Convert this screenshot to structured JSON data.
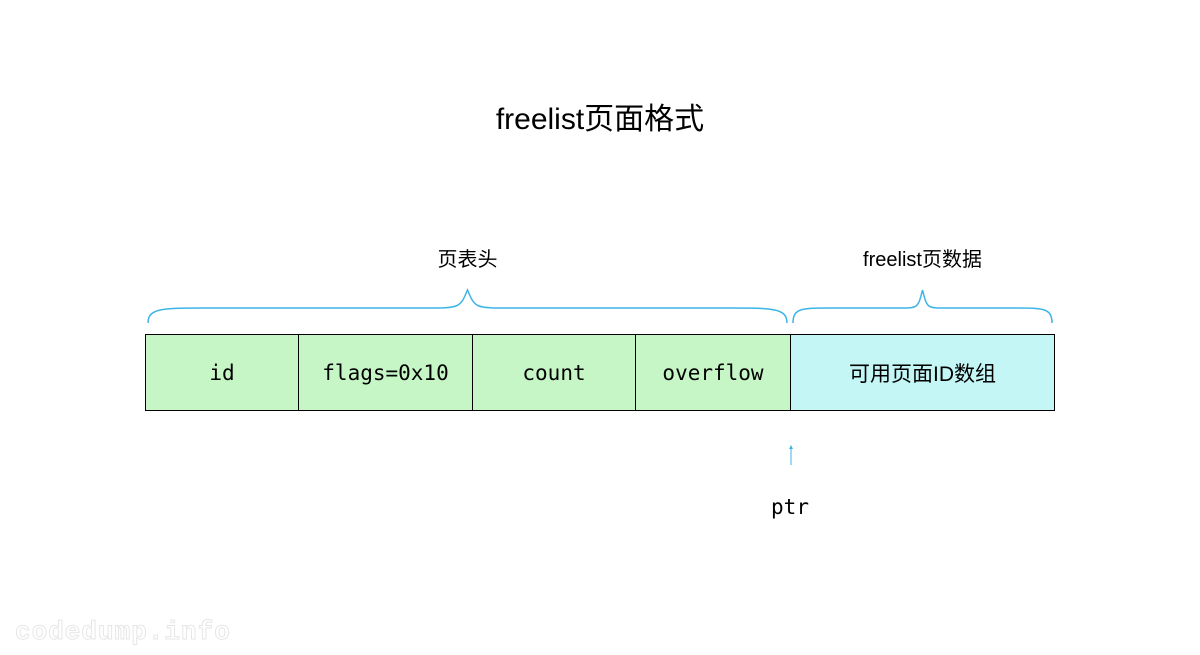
{
  "title": "freelist页面格式",
  "sections": {
    "header_label": "页表头",
    "data_label": "freelist页数据"
  },
  "cells": {
    "id": "id",
    "flags": "flags=0x10",
    "count": "count",
    "overflow": "overflow",
    "array": "可用页面ID数组"
  },
  "pointer": {
    "label": "ptr"
  },
  "watermark": "codedump.info",
  "colors": {
    "brace": "#3cb4e8",
    "arrow": "#3cb4e8",
    "header_fill": "#c6f6c5",
    "data_fill": "#c4f6f6"
  }
}
